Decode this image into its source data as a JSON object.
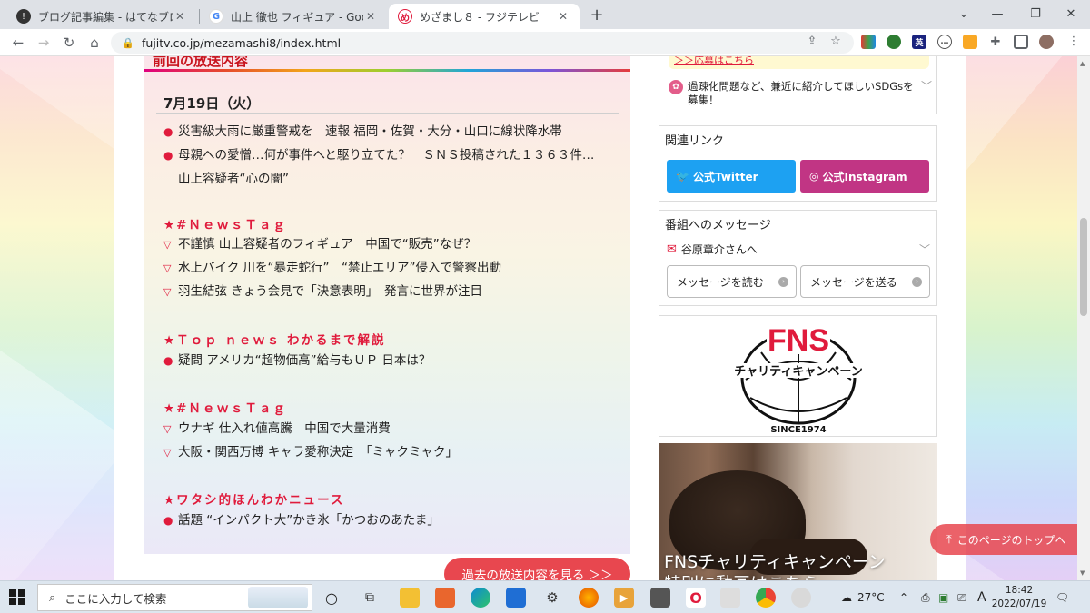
{
  "browser": {
    "tabs": [
      {
        "title": "ブログ記事編集 - はてなブログ",
        "active": false
      },
      {
        "title": "山上 徹也 フィギュア - Google 検索",
        "active": false
      },
      {
        "title": "めざまし８ - フジテレビ",
        "active": true
      }
    ],
    "new_tab": "+",
    "url": "fujitv.co.jp/mezamashi8/index.html",
    "extensions": [
      "英"
    ]
  },
  "main": {
    "section_heading": "前回の放送内容",
    "date": "7月19日（火）",
    "top_items": [
      {
        "lines": [
          "災害級大雨に厳重警戒を　速報 福岡・佐賀・大分・山口に線状降水帯"
        ]
      },
      {
        "lines": [
          "母親への愛憎…何が事件へと駆り立てた？　ＳＮＳ投稿された１３６３件…",
          "山上容疑者“心の闇”"
        ]
      }
    ],
    "groups": [
      {
        "category": "★#ＮｅｗｓＴａｇ",
        "marker": "triangle",
        "items": [
          "不謹慎 山上容疑者のフィギュア　中国で“販売”なぜ？",
          "水上バイク 川を“暴走蛇行”　“禁止エリア”侵入で警察出動",
          "羽生結弦 きょう会見で「決意表明」　発言に世界が注目"
        ]
      },
      {
        "category": "★Ｔｏｐ ｎｅｗｓ わかるまで解説",
        "marker": "dot",
        "items": [
          "疑問 アメリカ“超物価高”給与もＵＰ 日本は？"
        ]
      },
      {
        "category": "★#ＮｅｗｓＴａｇ",
        "marker": "triangle",
        "items": [
          "ウナギ 仕入れ値高騰　中国で大量消費",
          "大阪・関西万博 キャラ愛称決定　「ミャクミャク」"
        ]
      },
      {
        "category": "★ワタシ的ほんわかニュース",
        "marker": "dot",
        "items": [
          "話題 “インパクト大”かき氷「かつおのあたま」"
        ]
      }
    ],
    "past_button": "過去の放送内容を見る ＞＞"
  },
  "sidebar": {
    "notice_link": "＞＞応募はこちら",
    "sdgs_text": "過疎化問題など、兼近に紹介してほしいSDGsを募集！",
    "related_title": "関連リンク",
    "twitter_label": "公式Twitter",
    "instagram_label": "公式Instagram",
    "message_title": "番組へのメッセージ",
    "message_from": "谷原章介さんへ",
    "read_button": "メッセージを読む",
    "send_button": "メッセージを送る",
    "fns_logo_text": "FNS",
    "fns_logo_sub": "チャリティキャンペーン",
    "fns_logo_since": "SINCE1974",
    "photo_caption": "FNSチャリティキャンペーン",
    "photo_caption2": "特別に動画はこちら"
  },
  "page_top": "このページのトップへ",
  "taskbar": {
    "search_placeholder": "ここに入力して検索",
    "weather": "27°C",
    "ime": "A",
    "time": "18:42",
    "date": "2022/07/19"
  },
  "colors": {
    "accent_red": "#e01b3c",
    "twitter": "#1da1f2",
    "instagram": "#c13584",
    "button_red": "#e8474f"
  }
}
